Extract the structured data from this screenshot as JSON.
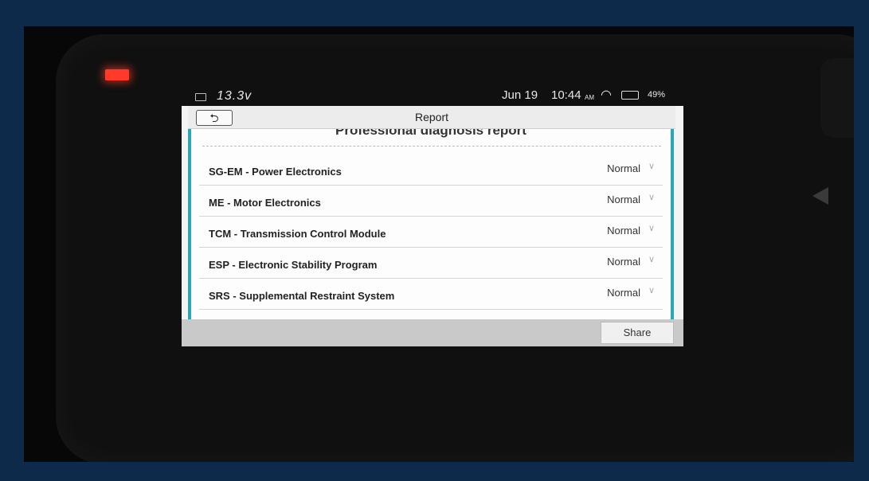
{
  "status_bar": {
    "voltage": "13.3v",
    "date": "Jun 19",
    "time": "10:44",
    "ampm": "AM",
    "battery_percent": "49%",
    "battery_level": 0.49,
    "colors": {
      "battery_fill": "#2fd34a"
    }
  },
  "app": {
    "title": "Report",
    "heading": "Professional diagnosis report",
    "modules": [
      {
        "name": "SG-EM - Power Electronics",
        "status": "Normal"
      },
      {
        "name": "ME - Motor Electronics",
        "status": "Normal"
      },
      {
        "name": "TCM - Transmission Control Module",
        "status": "Normal"
      },
      {
        "name": "ESP - Electronic Stability Program",
        "status": "Normal"
      },
      {
        "name": "SRS - Supplemental Restraint System",
        "status": "Normal"
      }
    ],
    "share_label": "Share",
    "icons": {
      "back": "back-arrow-icon",
      "expand": "chevron-down-icon"
    },
    "colors": {
      "accent": "#2aa6b4"
    }
  }
}
